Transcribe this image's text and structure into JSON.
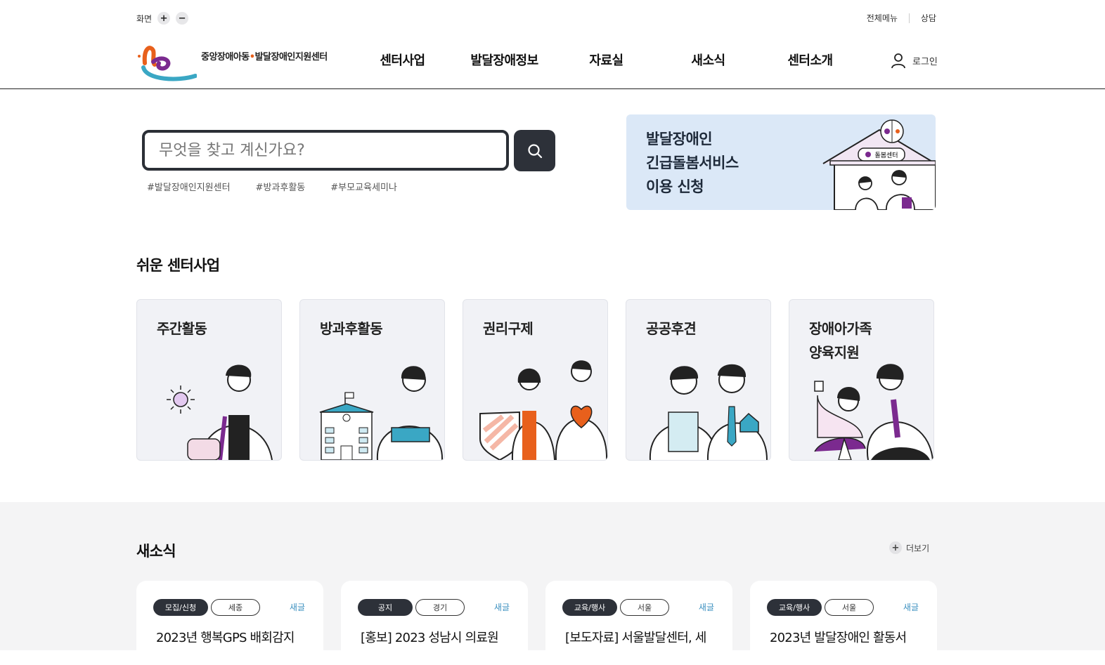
{
  "util": {
    "zoom_label": "화면",
    "zoom_in": "+",
    "zoom_out": "−",
    "all_menu": "전체메뉴",
    "consult": "상담"
  },
  "header": {
    "logo_text_1": "중앙장애아동",
    "logo_text_2": "발달장애인지원센터",
    "nav": [
      "센터사업",
      "발달장애정보",
      "자료실",
      "새소식",
      "센터소개"
    ],
    "login": "로그인"
  },
  "search": {
    "placeholder": "무엇을 찾고 계신가요?",
    "tags": [
      "#발달장애인지원센터",
      "#방과후활동",
      "#부모교육세미나"
    ]
  },
  "banner": {
    "line1": "발달장애인",
    "line2": "긴급돌봄서비스",
    "line3": "이용 신청",
    "sign": "돌봄센터"
  },
  "programs": {
    "title": "쉬운 센터사업",
    "items": [
      {
        "label": "주간활동"
      },
      {
        "label": "방과후활동"
      },
      {
        "label": "권리구제"
      },
      {
        "label": "공공후견"
      },
      {
        "label": "장애아가족\n양육지원"
      }
    ]
  },
  "news": {
    "title": "새소식",
    "more": "더보기",
    "items": [
      {
        "category": "모집/신청",
        "region": "세종",
        "new": "새글",
        "title": "2023년 행복GPS 배회감지"
      },
      {
        "category": "공지",
        "region": "경기",
        "new": "새글",
        "title": "[홍보] 2023 성남시 의료원"
      },
      {
        "category": "교육/행사",
        "region": "서울",
        "new": "새글",
        "title": "[보도자료] 서울발달센터, 세"
      },
      {
        "category": "교육/행사",
        "region": "서울",
        "new": "새글",
        "title": "2023년 발달장애인 활동서"
      }
    ]
  },
  "colors": {
    "dark": "#2d3139",
    "banner_bg": "#dbe8f7",
    "card_bg": "#f1f2f6",
    "accent_purple": "#7b2a8f",
    "accent_orange": "#e8601c",
    "accent_teal": "#3aa7c4",
    "new_badge": "#3a8fbf"
  }
}
